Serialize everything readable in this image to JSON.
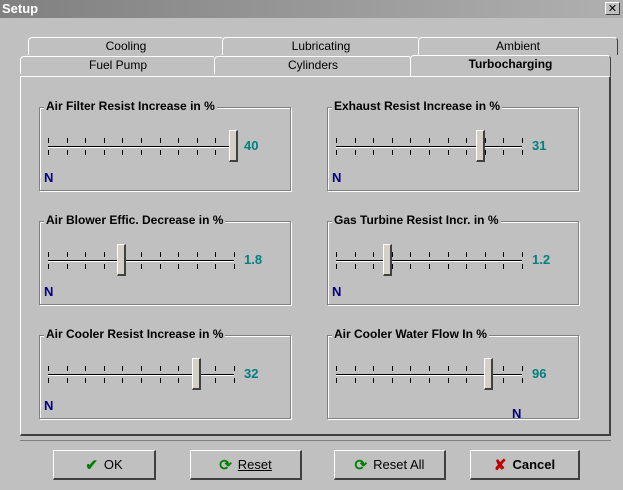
{
  "window": {
    "title": "Setup",
    "close_glyph": "✕"
  },
  "tabs_back": [
    "Cooling",
    "Lubricating",
    "Ambient"
  ],
  "tabs_front": [
    "Fuel Pump",
    "Cylinders",
    "Turbocharging"
  ],
  "active_tab": "Turbocharging",
  "groups": [
    {
      "label": "Air Filter Resist Increase in %",
      "value": "40",
      "level": 1.0,
      "n_label": "N"
    },
    {
      "label": "Exhaust Resist Increase in %",
      "value": "31",
      "level": 0.78,
      "n_label": "N"
    },
    {
      "label": "Air Blower Effic. Decrease in %",
      "value": "1.8",
      "level": 0.4,
      "n_label": "N"
    },
    {
      "label": "Gas Turbine Resist Incr. in %",
      "value": "1.2",
      "level": 0.28,
      "n_label": "N"
    },
    {
      "label": "Air Cooler Resist Increase in %",
      "value": "32",
      "level": 0.8,
      "n_label": "N"
    },
    {
      "label": "Air Cooler Water Flow In %",
      "value": "96",
      "level": 0.82,
      "n_label": "N"
    }
  ],
  "buttons": {
    "ok": "OK",
    "reset": "Reset",
    "reset_all": "Reset All",
    "cancel": "Cancel"
  },
  "icons": {
    "ok": "check-icon",
    "reset": "refresh-icon",
    "reset_all": "refresh-icon",
    "cancel": "x-icon"
  }
}
